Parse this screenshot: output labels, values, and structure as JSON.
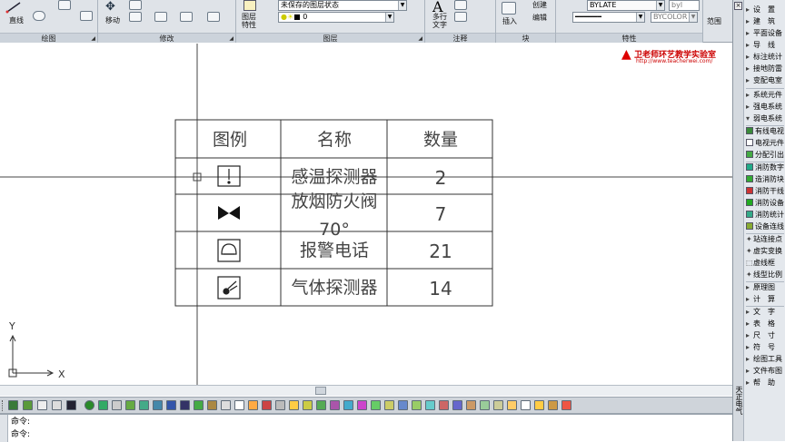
{
  "ribbon": {
    "panels": [
      {
        "title": "绘图"
      },
      {
        "title": "修改"
      },
      {
        "title": "图层"
      },
      {
        "title": "注释"
      },
      {
        "title": "块"
      },
      {
        "title": "特性"
      }
    ],
    "draw": {
      "line_label": "直线"
    },
    "modify": {
      "move_label": "移动"
    },
    "layer": {
      "layer_props_label": "图层\n特性",
      "state_value": "未保存的图层状态",
      "layer_value": "0"
    },
    "annotation": {
      "multiline_text_label": "多行\n文字"
    },
    "block": {
      "insert_label": "插入",
      "create_label": "创建",
      "edit_label": "编辑"
    },
    "properties": {
      "bylayer_value": "BYLATE",
      "bycolor_value": "BYCOLOR",
      "byl_value": "byl"
    },
    "right_cut_label": "范围"
  },
  "watermark": {
    "title": "卫老师环艺教学实验室",
    "url": "http://www.teacherwei.com/"
  },
  "legend_table": {
    "headers": [
      "图例",
      "名称",
      "数量"
    ],
    "rows": [
      {
        "name": "感温探测器",
        "qty": "2"
      },
      {
        "name": "放烟防火阀",
        "name2": "70°",
        "qty": "7"
      },
      {
        "name": "报警电话",
        "qty": "21"
      },
      {
        "name": "气体探测器",
        "qty": "14"
      }
    ]
  },
  "ucs": {
    "x_label": "X",
    "y_label": "Y"
  },
  "command": {
    "line1": "命令:",
    "line2": "命令:"
  },
  "sidebar": {
    "title": "天正电气",
    "group1": [
      "设　置",
      "建　筑",
      "平面设备",
      "导　线",
      "标注统计",
      "接地防雷",
      "变配电室"
    ],
    "group2": [
      "系统元件",
      "强电系统",
      "弱电系统"
    ],
    "group3": [
      "有线电视",
      "电视元件",
      "分配引出"
    ],
    "group4": [
      "消防数字",
      "造消防块",
      "消防干线",
      "消防设备",
      "消防统计",
      "设备连线"
    ],
    "group5": [
      "站连接点",
      "虚实变换",
      "虚线框",
      "线型比例"
    ],
    "group6": [
      "原理图",
      "计　算"
    ],
    "group7": [
      "文　字",
      "表　格",
      "尺　寸",
      "符　号",
      "绘图工具",
      "文件布图",
      "帮　助"
    ]
  }
}
